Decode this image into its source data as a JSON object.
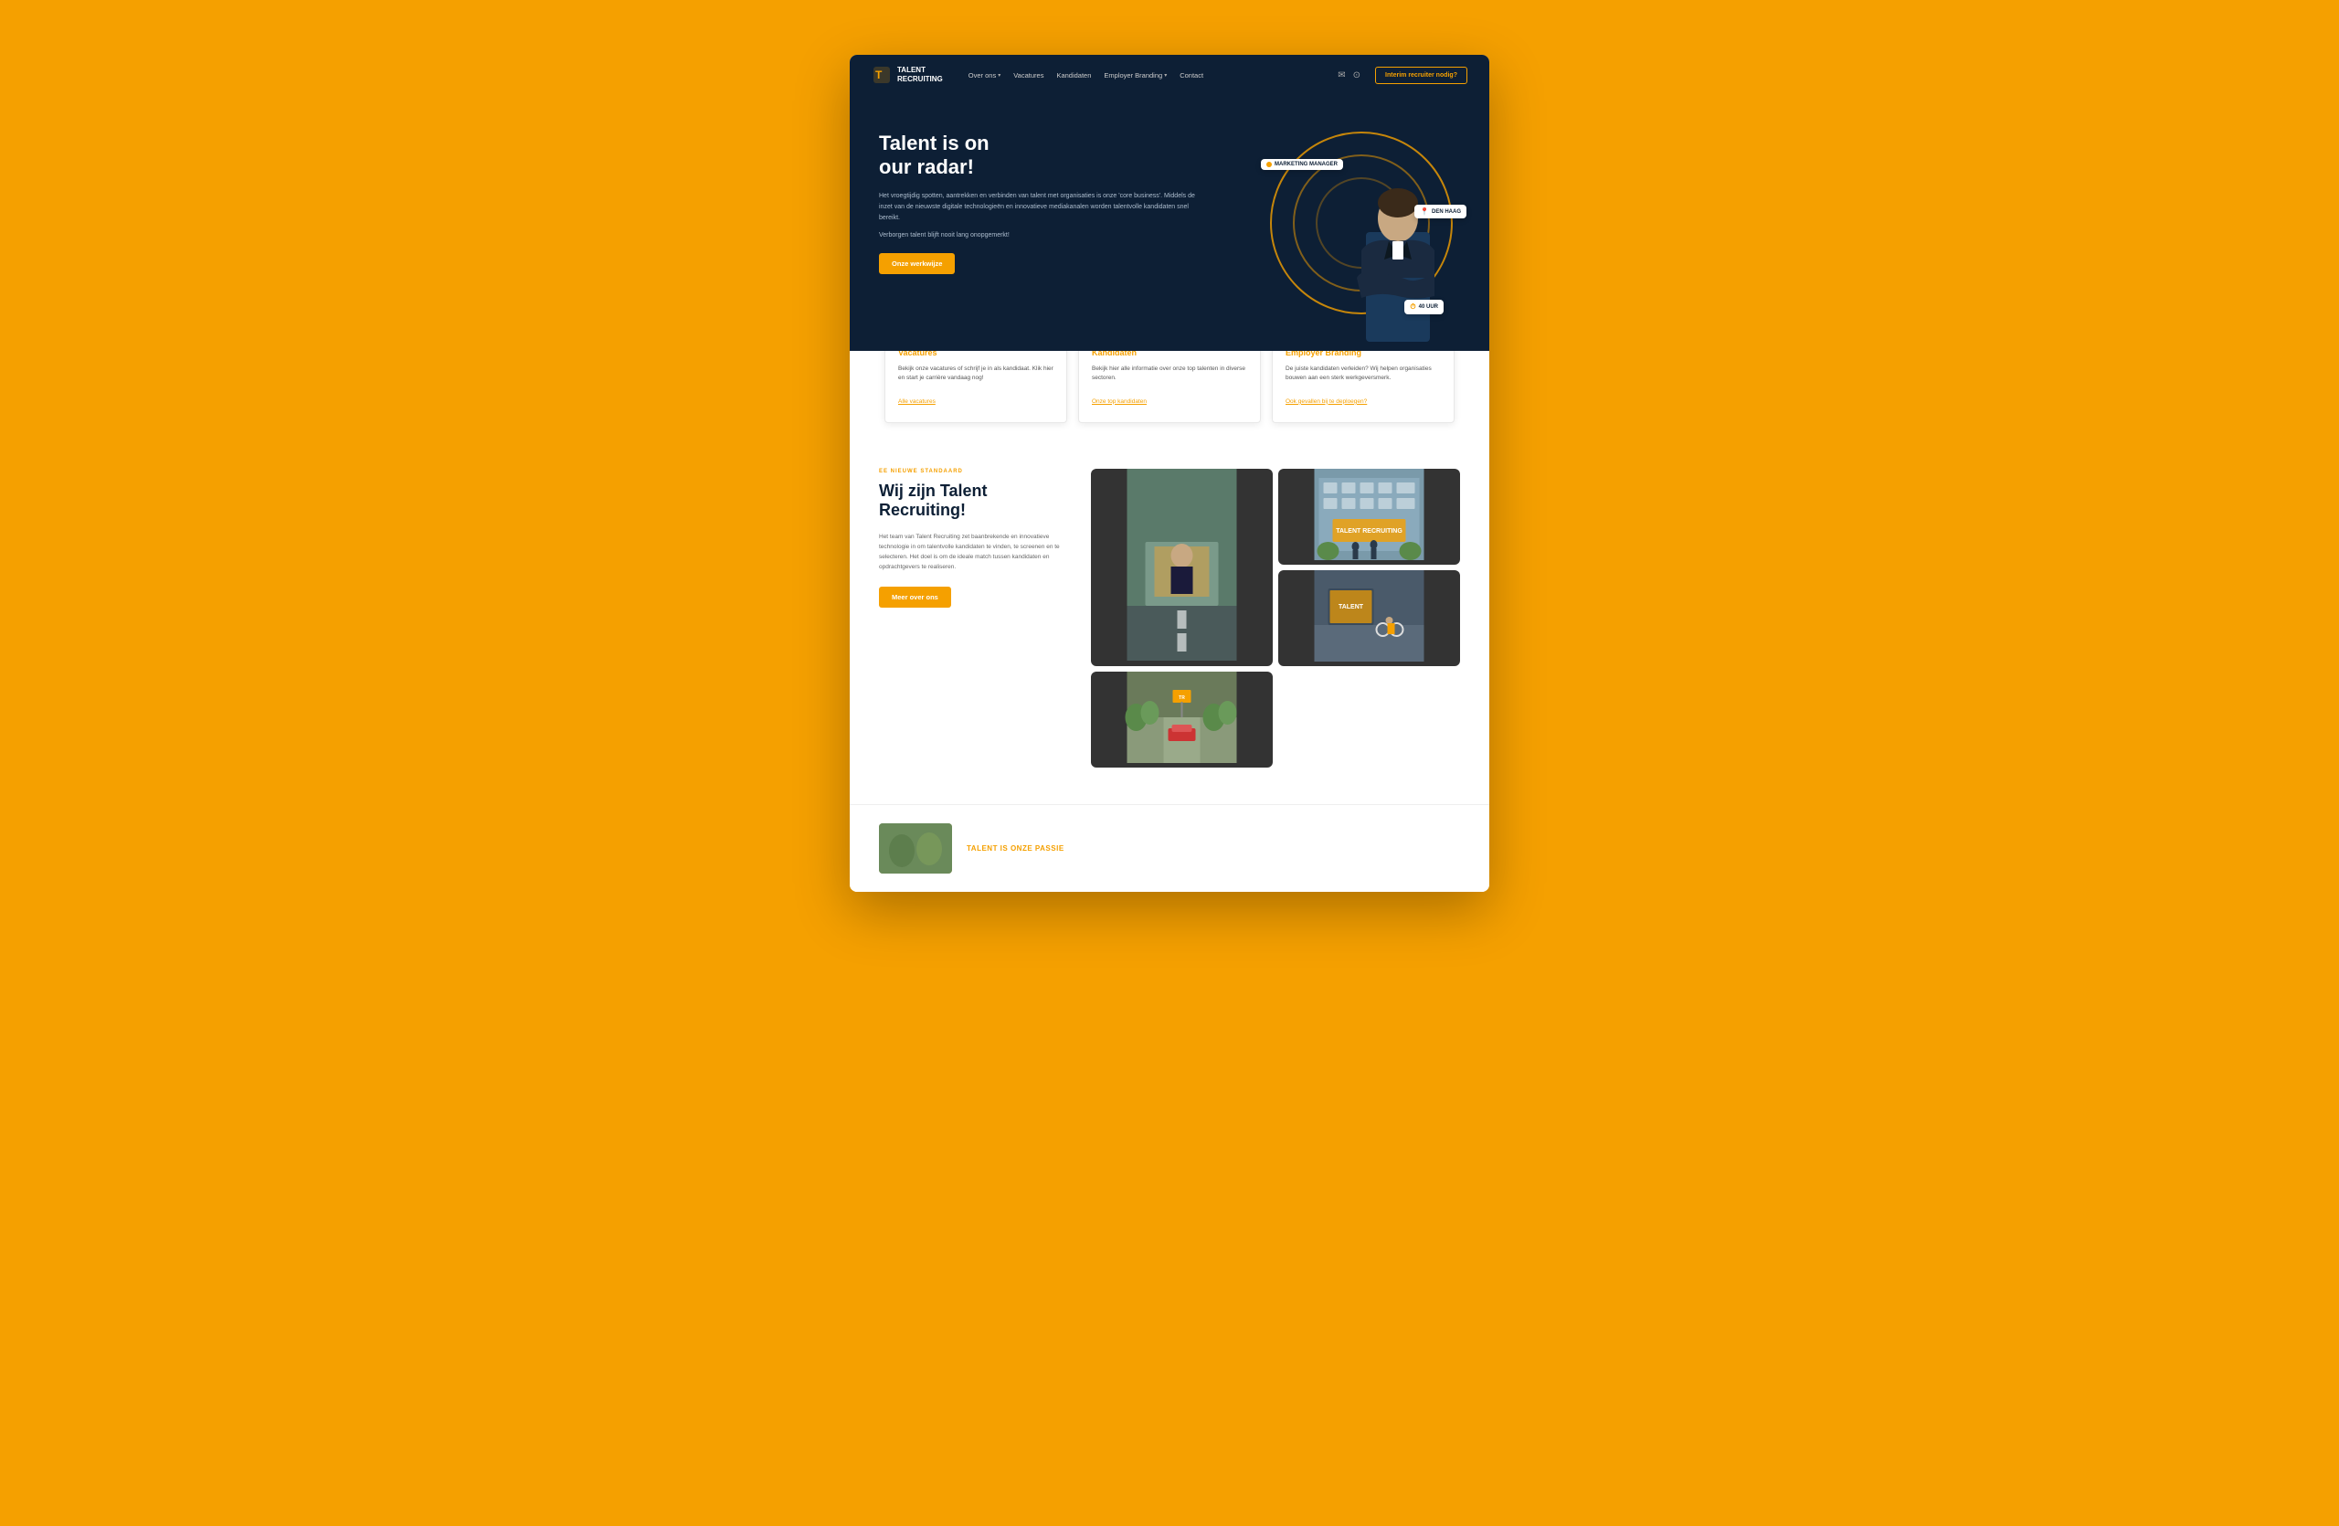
{
  "site": {
    "title": "TALENT RECRUITING"
  },
  "navbar": {
    "logo_line1": "TALENT",
    "logo_line2": "RECRUITING",
    "links": [
      {
        "label": "Over ons",
        "has_dropdown": true
      },
      {
        "label": "Vacatures",
        "has_dropdown": false
      },
      {
        "label": "Kandidaten",
        "has_dropdown": false
      },
      {
        "label": "Employer Branding",
        "has_dropdown": true
      },
      {
        "label": "Contact",
        "has_dropdown": false
      }
    ],
    "cta_button": "Interim recruiter nodig?"
  },
  "hero": {
    "title_line1": "Talent is on",
    "title_line2": "our radar!",
    "description": "Het vroegtijdig spotten, aantrekken en verbinden van talent met organisaties is onze 'core business'. Middels de inzet van de nieuwste digitale technologieën en innovatieve mediakanalen worden talentvolle kandidaten snel bereikt.",
    "tagline": "Verborgen talent blijft nooit lang onopgemerkt!",
    "cta_button": "Onze werkwijze",
    "badge_job": "MARKETING MANAGER",
    "badge_location": "DEN HAAG",
    "badge_hours": "40 UUR"
  },
  "cards": [
    {
      "title": "Vacatures",
      "text": "Bekijk onze vacatures of schrijf je in als kandidaat. Klik hier en start je carrière vandaag nog!",
      "link": "Alle vacatures"
    },
    {
      "title": "Kandidaten",
      "text": "Bekijk hier alle informatie over onze top talenten in diverse sectoren.",
      "link": "Onze top kandidaten"
    },
    {
      "title": "Employer Branding",
      "text": "De juiste kandidaten verleiden? Wij helpen organisaties bouwen aan een sterk werkgeversmerk.",
      "link": "Ook gevallen bij te deploegen?"
    }
  ],
  "about": {
    "tag": "EE NIEUWE STANDAARD",
    "title_line1": "Wij zijn Talent",
    "title_line2": "Recruiting!",
    "text": "Het team van Talent Recruiting zet baanbrekende en innovatieve technologie in om talentvolle kandidaten te vinden, te screenen en te selecteren. Het doel is om de ideale match tussen kandidaten en opdrachtgevers te realiseren.",
    "cta_button": "Meer over ons"
  },
  "bottom_teaser": {
    "label": "TALENT IS ONZE PASSIE"
  }
}
